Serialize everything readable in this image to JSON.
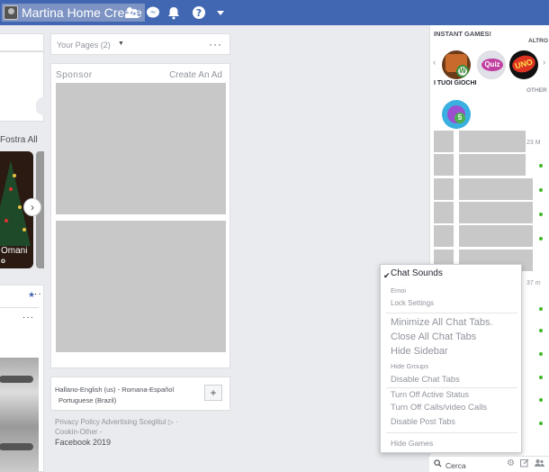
{
  "topbar": {
    "profile_name": "Martina Home Create",
    "color": "#4267b2"
  },
  "left": {
    "fostra_label": "Fostra All",
    "tree_caption": "Omani",
    "tree_caption2": "o"
  },
  "pages": {
    "label": "Your Pages (2)",
    "more": "···"
  },
  "sponsor": {
    "label": "Sponsor",
    "create_ad": "Create An Ad"
  },
  "languages": {
    "line1": "Hallano-English (us) - Romana-Español",
    "line2": "Portuguese (Brazil)",
    "add": "+"
  },
  "footer": {
    "line1": "Privacy Policy Advertising Sceglitul ▷ ·",
    "line2": "Cookin-Other -",
    "copyright": "Facebook 2019"
  },
  "instant_games": {
    "title": "INSTANT GAMES!",
    "more": "ALTRO",
    "my_games": "I TUOI GIOCHI",
    "other": "OTHER",
    "games": [
      {
        "name": "Words",
        "icon": "words-game-icon"
      },
      {
        "name": "Quiz",
        "icon": "quiz-game-icon"
      },
      {
        "name": "UNO",
        "icon": "uno-game-icon"
      },
      {
        "name": "5",
        "icon": "bubble-game-icon"
      }
    ]
  },
  "chat_list": {
    "time1": "23 M",
    "time2": "37 m"
  },
  "chat_menu": {
    "items": [
      {
        "label": "Chat Sounds",
        "checked": true
      },
      {
        "label": "Emoi"
      },
      {
        "label": "Lock Settings"
      },
      {
        "label": "Minimize All Chat Tabs."
      },
      {
        "label": "Close All Chat Tabs"
      },
      {
        "label": "Hide Sidebar"
      },
      {
        "label": "Hide Groups"
      },
      {
        "label": "Disable Chat Tabs"
      },
      {
        "label": "Turn Off Active Status"
      },
      {
        "label": "Turn Off Calls/video Calls"
      },
      {
        "label": "Disable Post Tabs"
      },
      {
        "label": "Hide Games"
      }
    ]
  },
  "search": {
    "placeholder": "Cerca"
  }
}
